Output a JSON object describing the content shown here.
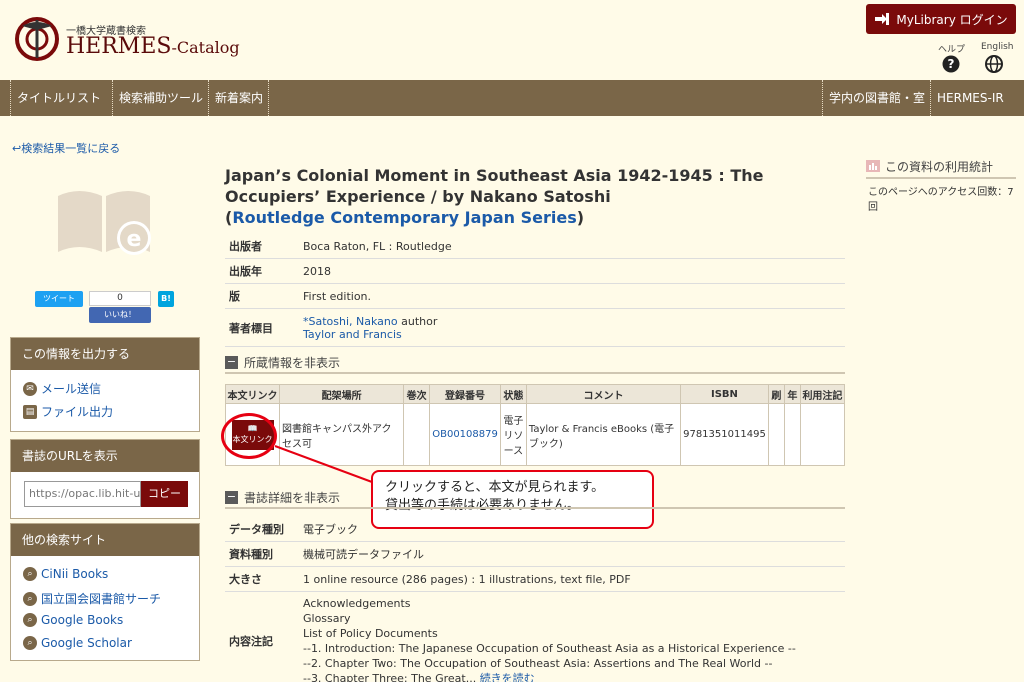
{
  "header": {
    "logo_sub": "一橋大学蔵書検索",
    "logo_name": "HERMES",
    "logo_suffix": "-Catalog",
    "login_label": "MyLibrary ログイン",
    "help_label": "ヘルプ",
    "english_label": "English"
  },
  "nav": {
    "left": [
      "タイトルリスト",
      "検索補助ツール",
      "新着案内"
    ],
    "right": [
      "学内の図書館・室",
      "HERMES-IR"
    ]
  },
  "back_link": "検索結果一覧に戻る",
  "share": {
    "tweet": "ツイート",
    "like_count": "0",
    "like": "いいね！",
    "hatena": "B!"
  },
  "sidebar": {
    "output": {
      "title": "この情報を出力する",
      "items": [
        "メール送信",
        "ファイル出力"
      ]
    },
    "url": {
      "title": "書誌のURLを表示",
      "value": "https://opac.lib.hit-u",
      "copy": "コピー"
    },
    "other": {
      "title": "他の検索サイト",
      "items": [
        "CiNii Books",
        "国立国会図書館サーチ",
        "Google Books",
        "Google Scholar"
      ]
    }
  },
  "record": {
    "title": "Japan’s Colonial Moment in Southeast Asia 1942-1945 : The Occupiers’ Experience / by Nakano Satoshi",
    "series_open": "(",
    "series": "Routledge Contemporary Japan Series",
    "series_close": ")",
    "fields": {
      "publisher_label": "出版者",
      "publisher": "Boca Raton, FL : Routledge",
      "year_label": "出版年",
      "year": "2018",
      "edition_label": "版",
      "edition": "First edition.",
      "author_label": "著者標目",
      "author1": "*Satoshi, Nakano",
      "author1_role": "author",
      "author2": "Taylor and Francis"
    }
  },
  "holdings": {
    "toggle_label": "所蔵情報を非表示",
    "headers": [
      "本文リンク",
      "配架場所",
      "巻次",
      "登録番号",
      "状態",
      "コメント",
      "ISBN",
      "刷",
      "年",
      "利用注記"
    ],
    "row": {
      "fulltext": "本文リンク",
      "location": "図書館キャンパス外アクセス可",
      "volume": "",
      "reg_no": "OB00108879",
      "status": "電子リソース",
      "comment": "Taylor & Francis eBooks (電子ブック)",
      "isbn": "9781351011495",
      "print": "",
      "year": "",
      "note": ""
    }
  },
  "callout": {
    "line1": "クリックすると、本文が見られます。",
    "line2": "貸出等の手続は必要ありません。"
  },
  "details": {
    "toggle_label": "書誌詳細を非表示",
    "type_label": "データ種別",
    "type": "電子ブック",
    "material_label": "資料種別",
    "material": "機械可読データファイル",
    "size_label": "大きさ",
    "size": "1 online resource (286 pages) : 1 illustrations, text file, PDF",
    "contents_label": "内容注記",
    "contents": [
      "Acknowledgements",
      "Glossary",
      "List of Policy Documents",
      "--1. Introduction: The Japanese Occupation of Southeast Asia as a Historical Experience --",
      "--2. Chapter Two: The Occupation of Southeast Asia: Assertions and The Real World --",
      "--3. Chapter Three: The Great..."
    ],
    "read_more": "続きを読む"
  },
  "stats": {
    "title": "この資料の利用統計",
    "text": "このページへのアクセス回数：7回"
  },
  "colors": {
    "nav_bg": "#7a6648",
    "brand_red": "#7a0a0a",
    "highlight_red": "#e60012",
    "page_bg": "#fffbe8",
    "link": "#1b5aa8"
  }
}
